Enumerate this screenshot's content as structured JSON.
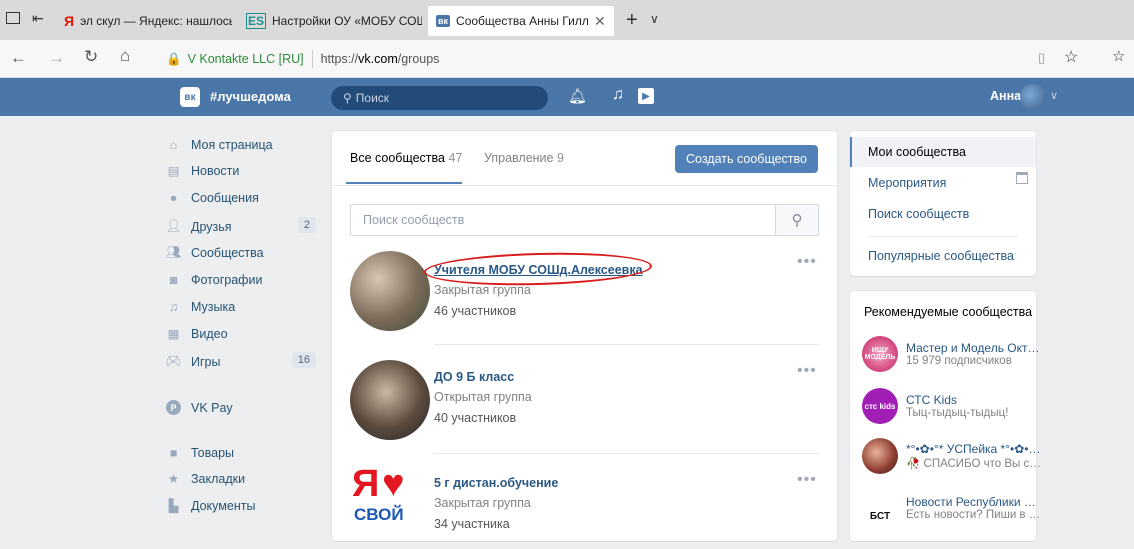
{
  "browser": {
    "tabs": [
      {
        "label": "эл скул — Яндекс: нашлось"
      },
      {
        "label": "Настройки ОУ «МОБУ СОШ"
      },
      {
        "label": "Сообщества Анны Гилл"
      }
    ],
    "new_tab": "+",
    "site_identity": "V Kontakte LLC [RU]",
    "url_prefix": "https://",
    "url_domain": "vk.com",
    "url_path": "/groups"
  },
  "vk_header": {
    "logo": "вк",
    "slogan": "#лучшедома",
    "search_placeholder": "Поиск",
    "user_name": "Анна"
  },
  "left_nav": [
    {
      "label": "Моя страница",
      "icon": "home-icon",
      "count": ""
    },
    {
      "label": "Новости",
      "icon": "news-icon",
      "count": ""
    },
    {
      "label": "Сообщения",
      "icon": "messages-icon",
      "count": ""
    },
    {
      "label": "Друзья",
      "icon": "friends-icon",
      "count": "2"
    },
    {
      "label": "Сообщества",
      "icon": "groups-icon",
      "count": ""
    },
    {
      "label": "Фотографии",
      "icon": "camera-icon",
      "count": ""
    },
    {
      "label": "Музыка",
      "icon": "music-icon",
      "count": ""
    },
    {
      "label": "Видео",
      "icon": "video-icon",
      "count": ""
    },
    {
      "label": "Игры",
      "icon": "games-icon",
      "count": "16"
    },
    {
      "label": "VK Pay",
      "icon": "vkpay-icon",
      "count": ""
    },
    {
      "label": "Товары",
      "icon": "bag-icon",
      "count": ""
    },
    {
      "label": "Закладки",
      "icon": "star-icon",
      "count": ""
    },
    {
      "label": "Документы",
      "icon": "document-icon",
      "count": ""
    }
  ],
  "groups_panel": {
    "tab_all": "Все сообщества",
    "tab_all_count": "47",
    "tab_manage": "Управление",
    "tab_manage_count": "9",
    "create_button": "Создать сообщество",
    "search_placeholder": "Поиск сообществ",
    "groups": [
      {
        "name": "Учителя МОБУ СОШд.Алексеевка",
        "type": "Закрытая группа",
        "members": "46 участников"
      },
      {
        "name": "ДО 9 Б класс",
        "type": "Открытая группа",
        "members": "40 участников"
      },
      {
        "name": "5 г дистан.обучение",
        "type": "Закрытая группа",
        "members": "34 участника",
        "logo_text_top": "Я",
        "logo_text_bottom": "СВОЙ"
      }
    ]
  },
  "right_menu": {
    "items": [
      "Мои сообщества",
      "Мероприятия",
      "Поиск сообществ",
      "Популярные сообщества"
    ]
  },
  "recommended": {
    "title": "Рекомендуемые сообщества",
    "items": [
      {
        "name": "Мастер и Модель Октяб…",
        "sub": "15 979 подписчиков",
        "avatar_text": "ИЩУ МОДЕЛЬ"
      },
      {
        "name": "СТС Kids",
        "sub": "Тыц-тыдыц-тыдыц!",
        "avatar_text": "стс kids"
      },
      {
        "name": "*°•✿•°* УСПейка *°•✿•С…",
        "sub": "🥀 СПАСИБО что Вы с н…",
        "avatar_text": ""
      },
      {
        "name": "Новости Республики Ба…",
        "sub": "Есть новости? Пиши в …",
        "avatar_text": "БСТ"
      }
    ]
  },
  "colors": {
    "vk_blue": "#4a76a8",
    "link": "#2a5885",
    "annotation": "#d81d1d"
  }
}
